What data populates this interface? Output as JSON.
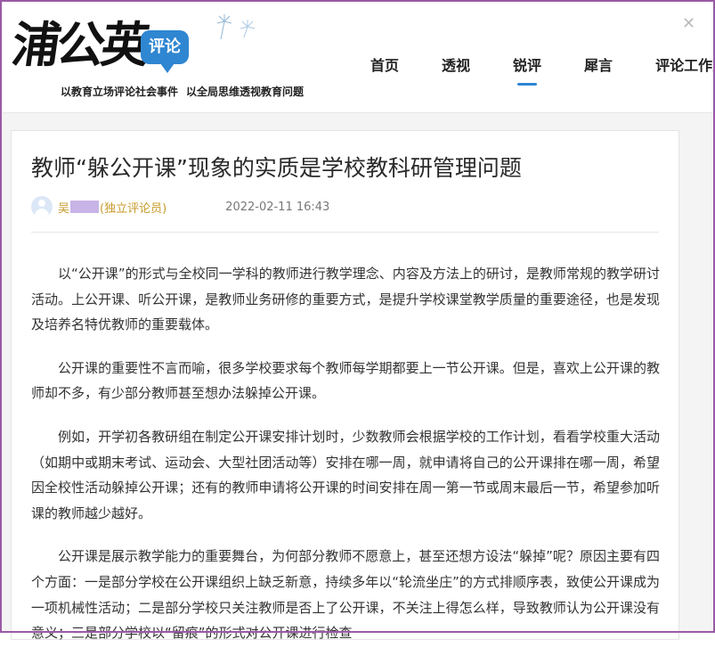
{
  "header": {
    "logo_text": "浦公英",
    "logo_badge": "评论",
    "tagline": [
      "以教育立场评论社会事件",
      "以全局思维透视教育问题"
    ],
    "nav": [
      {
        "label": "首页",
        "active": false
      },
      {
        "label": "透视",
        "active": false
      },
      {
        "label": "锐评",
        "active": true
      },
      {
        "label": "犀言",
        "active": false
      },
      {
        "label": "评论工作室",
        "active": false
      }
    ]
  },
  "article": {
    "title": "教师“躲公开课”现象的实质是学校教科研管理问题",
    "author_prefix": "吴",
    "author_role": "(独立评论员)",
    "date": "2022-02-11 16:43",
    "paragraphs": [
      "以“公开课”的形式与全校同一学科的教师进行教学理念、内容及方法上的研讨，是教师常规的教学研讨活动。上公开课、听公开课，是教师业务研修的重要方式，是提升学校课堂教学质量的重要途径，也是发现及培养名特优教师的重要载体。",
      "公开课的重要性不言而喻，很多学校要求每个教师每学期都要上一节公开课。但是，喜欢上公开课的教师却不多，有少部分教师甚至想办法躲掉公开课。",
      "例如，开学初各教研组在制定公开课安排计划时，少数教师会根据学校的工作计划，看看学校重大活动（如期中或期末考试、运动会、大型社团活动等）安排在哪一周，就申请将自己的公开课排在哪一周，希望因全校性活动躲掉公开课；还有的教师申请将公开课的时间安排在周一第一节或周末最后一节，希望参加听课的教师越少越好。",
      "公开课是展示教学能力的重要舞台，为何部分教师不愿意上，甚至还想方设法“躲掉”呢？原因主要有四个方面：一是部分学校在公开课组织上缺乏新意，持续多年以“轮流坐庄”的方式排顺序表，致使公开课成为一项机械性活动；二是部分学校只关注教师是否上了公开课，不关注上得怎么样，导致教师认为公开课没有意义；三是部分学校以“留痕”的形式对公开课进行检查"
    ]
  }
}
